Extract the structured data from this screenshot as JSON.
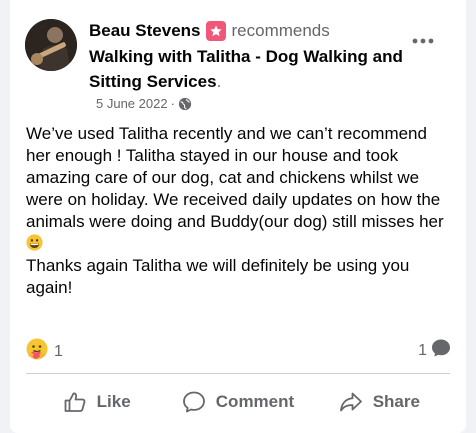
{
  "post": {
    "author": "Beau Stevens",
    "action_text": "recommends",
    "page_name": "Walking with Talitha - Dog Walking and Sitting Services",
    "page_name_suffix": ".",
    "date": "5 June 2022",
    "separator": "·",
    "privacy_icon": "globe-icon",
    "body": "We’ve used Talitha recently and we can’t recommend her enough ! Talitha stayed in our house and took amazing care of our dog, cat and chickens whilst we were on holiday. We received daily updates on how the animals were doing and Buddy(our dog) still misses her",
    "body_emoji": "grinning-face",
    "body_after": "Thanks again Talitha we will definitely be using you again!"
  },
  "stats": {
    "reaction_icon": "care-reaction-icon",
    "reaction_count": "1",
    "comment_count": "1",
    "comment_icon": "comment-bubble-icon"
  },
  "actions": {
    "like_label": "Like",
    "comment_label": "Comment",
    "share_label": "Share"
  },
  "colors": {
    "text_primary": "#050505",
    "text_secondary": "#65676b",
    "recommend_badge": "#f0587a",
    "divider": "#ced0d4",
    "background": "#f0f2f5"
  }
}
